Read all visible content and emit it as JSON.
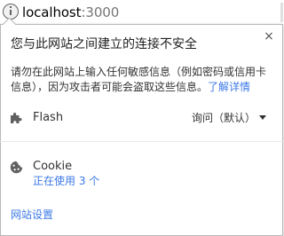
{
  "address_bar": {
    "host": "localhost",
    "port": ":3000",
    "icon": "info-icon"
  },
  "bubble": {
    "title": "您与此网站之间建立的连接不安全",
    "close_label": "×",
    "description": "请勿在此网站上输入任何敏感信息（例如密码或信用卡信息），因为攻击者可能会盗取这些信息。",
    "learn_more": "了解详情"
  },
  "permissions": [
    {
      "label": "Flash",
      "icon": "puzzle-icon",
      "value": "询问（默认）"
    }
  ],
  "cookies": {
    "label": "Cookie",
    "icon": "cookie-icon",
    "status": "正在使用 3 个"
  },
  "site_settings": "网站设置",
  "colors": {
    "link": "#3b78e7",
    "text": "#333333",
    "border": "#b8b8b8",
    "icon": "#606060"
  }
}
